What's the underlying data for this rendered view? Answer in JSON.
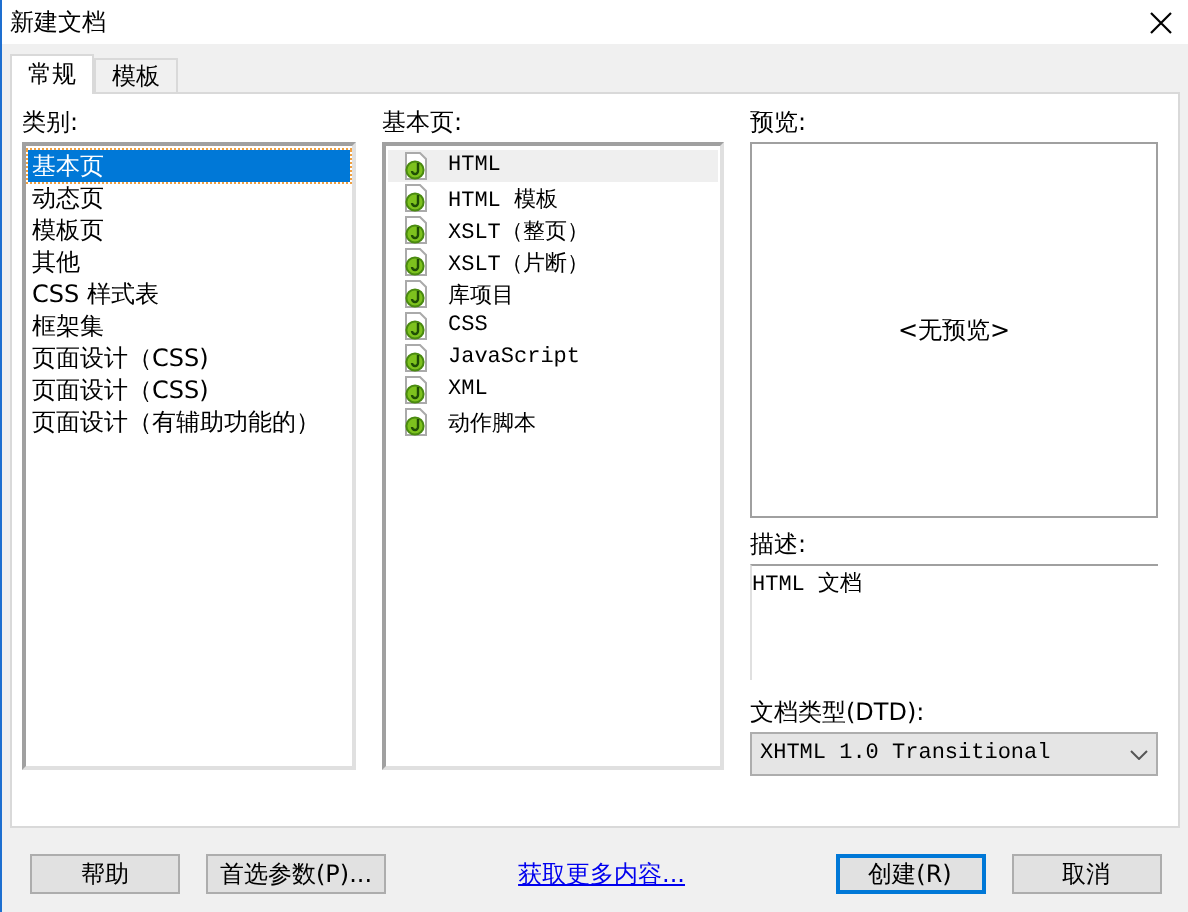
{
  "window": {
    "title": "新建文档"
  },
  "tabs": [
    {
      "label": "常规",
      "selected": true
    },
    {
      "label": "模板",
      "selected": false
    }
  ],
  "category": {
    "label": "类别:",
    "items": [
      {
        "label": "基本页",
        "selected": true
      },
      {
        "label": "动态页",
        "selected": false
      },
      {
        "label": "模板页",
        "selected": false
      },
      {
        "label": "其他",
        "selected": false
      },
      {
        "label": "CSS 样式表",
        "selected": false
      },
      {
        "label": "框架集",
        "selected": false
      },
      {
        "label": "页面设计（CSS)",
        "selected": false
      },
      {
        "label": "页面设计（CSS)",
        "selected": false
      },
      {
        "label": "页面设计（有辅助功能的）",
        "selected": false
      }
    ]
  },
  "basic_page": {
    "label": "基本页:",
    "items": [
      {
        "label": "HTML",
        "selected": true
      },
      {
        "label": "HTML 模板",
        "selected": false
      },
      {
        "label": "XSLT（整页）",
        "selected": false
      },
      {
        "label": "XSLT（片断）",
        "selected": false
      },
      {
        "label": "库项目",
        "selected": false
      },
      {
        "label": "CSS",
        "selected": false
      },
      {
        "label": "JavaScript",
        "selected": false
      },
      {
        "label": "XML",
        "selected": false
      },
      {
        "label": "动作脚本",
        "selected": false
      }
    ]
  },
  "preview": {
    "label": "预览:",
    "text": "<无预览>"
  },
  "description": {
    "label": "描述:",
    "value": "HTML 文档"
  },
  "doctype": {
    "label": "文档类型(DTD):",
    "value": "XHTML 1.0 Transitional"
  },
  "buttons": [
    {
      "label": "帮助",
      "kind": "button"
    },
    {
      "label": "首选参数(P)...",
      "kind": "button"
    },
    {
      "label": "获取更多内容...",
      "kind": "link"
    },
    {
      "label": "创建(R)",
      "kind": "default"
    },
    {
      "label": "取消",
      "kind": "button"
    }
  ]
}
